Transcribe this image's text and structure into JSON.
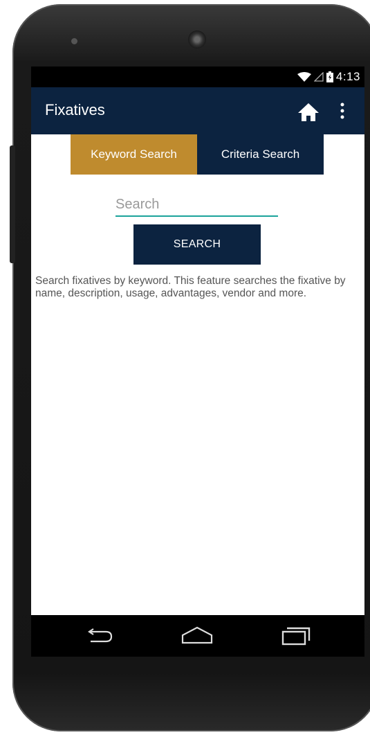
{
  "status_bar": {
    "time": "4:13",
    "icons": [
      "wifi-icon",
      "signal-icon",
      "battery-icon"
    ]
  },
  "app_bar": {
    "title": "Fixatives",
    "icons": [
      "home-icon",
      "overflow-menu-icon"
    ]
  },
  "tabs": [
    {
      "label": "Keyword Search",
      "active": true
    },
    {
      "label": "Criteria Search",
      "active": false
    }
  ],
  "search": {
    "placeholder": "Search",
    "value": "",
    "button_label": "SEARCH"
  },
  "description": "Search fixatives by keyword. This feature searches the fixative by name, description, usage, advantages, vendor and more.",
  "nav_bar": {
    "icons": [
      "back-icon",
      "home-icon",
      "recent-apps-icon"
    ]
  },
  "colors": {
    "primary": "#0c2340",
    "active_tab": "#bf8b2e",
    "input_underline": "#1aa39a"
  }
}
